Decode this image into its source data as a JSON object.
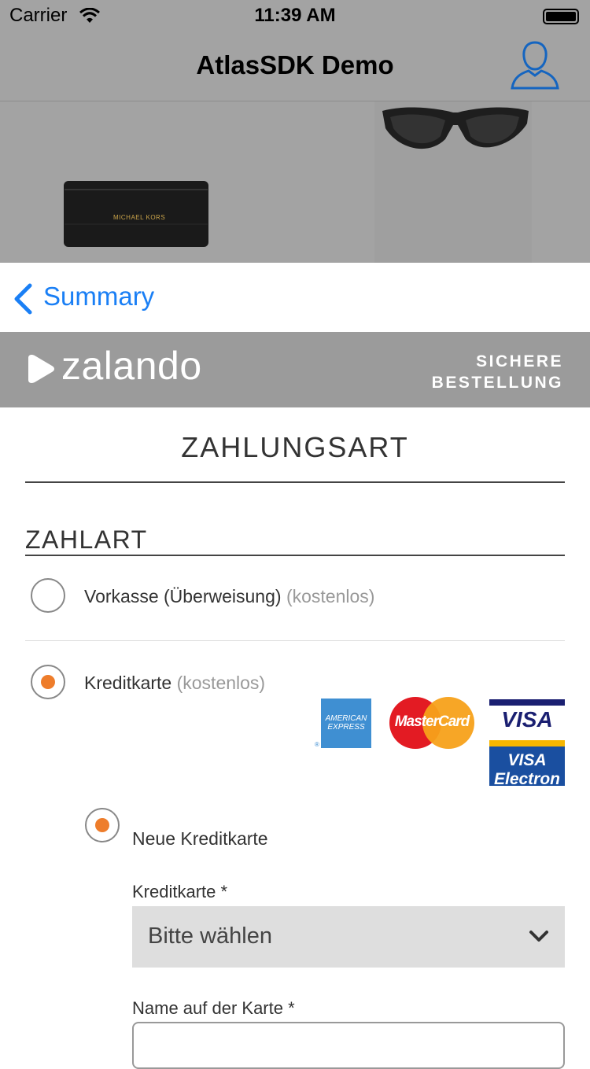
{
  "status_bar": {
    "carrier": "Carrier",
    "time": "11:39 AM"
  },
  "nav": {
    "title": "AtlasSDK Demo",
    "profile_icon": "user-profile-icon"
  },
  "hero": {
    "wallet_brand": "MICHAEL KORS"
  },
  "sheet_nav": {
    "back_label": "Summary"
  },
  "zalando_header": {
    "logo": "zalando",
    "secure_line1": "SICHERE",
    "secure_line2": "BESTELLUNG"
  },
  "page": {
    "title": "ZAHLUNGSART",
    "section_title": "ZAHLART"
  },
  "payment_options": [
    {
      "label": "Vorkasse (Überweisung)",
      "note": "(kostenlos)",
      "selected": false
    },
    {
      "label": "Kreditkarte",
      "note": "(kostenlos)",
      "selected": true
    }
  ],
  "card_logos": {
    "amex_line1": "AMERICAN",
    "amex_line2": "EXPRESS",
    "mastercard": "MasterCard",
    "visa": "VISA",
    "visa_electron_line1": "VISA",
    "visa_electron_line2": "Electron"
  },
  "new_card": {
    "label": "Neue Kreditkarte",
    "selected": true
  },
  "form": {
    "card_type_label": "Kreditkarte *",
    "card_type_value": "Bitte wählen",
    "name_label": "Name auf der Karte *",
    "name_value": ""
  },
  "colors": {
    "accent": "#ee7d2b",
    "link": "#1a7ff5",
    "header_gray": "#9b9b9b"
  }
}
